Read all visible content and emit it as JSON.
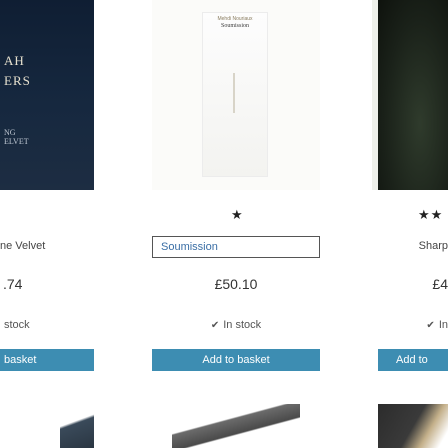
{
  "products": [
    {
      "cover_lines": [
        "AH",
        "ERS"
      ],
      "cover_small": [
        "NG",
        "ELVET"
      ],
      "variant": "ne Velvet",
      "price": ".74",
      "stock": "stock",
      "button": "basket",
      "rating": 0
    },
    {
      "cover_author": "Mehdi Nouriaux",
      "cover_title": "Soumission",
      "variant": "Soumission",
      "price": "£50.10",
      "stock": "In stock",
      "button": "Add to basket",
      "rating": 1
    },
    {
      "variant": "Sharp",
      "price": "£4",
      "stock": "In",
      "button": "Add to",
      "rating": 2
    }
  ],
  "icons": {
    "star": "star-icon",
    "check": "check-icon"
  },
  "colors": {
    "button_bg": "#3d8db2",
    "button_text": "#ffffff",
    "select_border": "#555555"
  }
}
